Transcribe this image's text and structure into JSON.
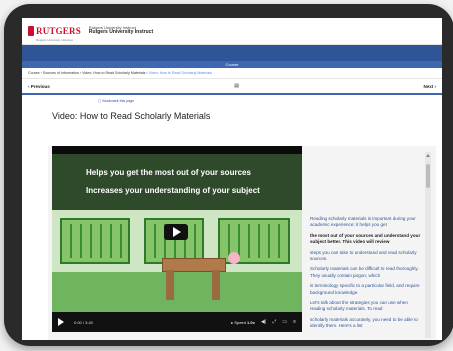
{
  "header": {
    "logo_text": "RUTGERS",
    "logo_subtext": "Rutgers University Libraries",
    "brand_line1": "Rutgers University Instruct",
    "brand_line2": "Rutgers University Instruct"
  },
  "course_bar": {
    "label": "Course"
  },
  "breadcrumb": {
    "items": [
      "Course",
      "Sources of Information",
      "Video: How to Read Scholarly Materials",
      "Video: How to Read Scholarly Materials"
    ]
  },
  "pager": {
    "previous_label": "Previous",
    "next_label": "Next",
    "middle_icon": "book-icon"
  },
  "bookmark": {
    "label": "Bookmark this page"
  },
  "page": {
    "title": "Video: How to Read Scholarly Materials"
  },
  "video": {
    "caption_line1": "Helps you get the most out of your sources",
    "caption_line2": "Increases your understanding of your subject",
    "time": "0:00 / 3:40",
    "speed_label": "Speed",
    "speed_value": "1.0x"
  },
  "transcript": {
    "lines": [
      "Reading scholarly materials is important during your academic experience; it helps you get",
      "the most out of your sources and understand your subject better. This video will review",
      "steps you can take to understand and read scholarly sources.",
      "Scholarly materials can be difficult to read thoroughly. They usually contain jargon, which",
      "is terminology specific to a particular field, and require background knowledge.",
      "Let's talk about the strategies you can use when reading scholarly materials. To read",
      "scholarly materials accurately, you need to be able to identify them. Here's a list"
    ],
    "active_index": 1
  },
  "colors": {
    "brand_red": "#c8102e",
    "nav_blue": "#2f5597",
    "link_blue": "#2f5597"
  }
}
